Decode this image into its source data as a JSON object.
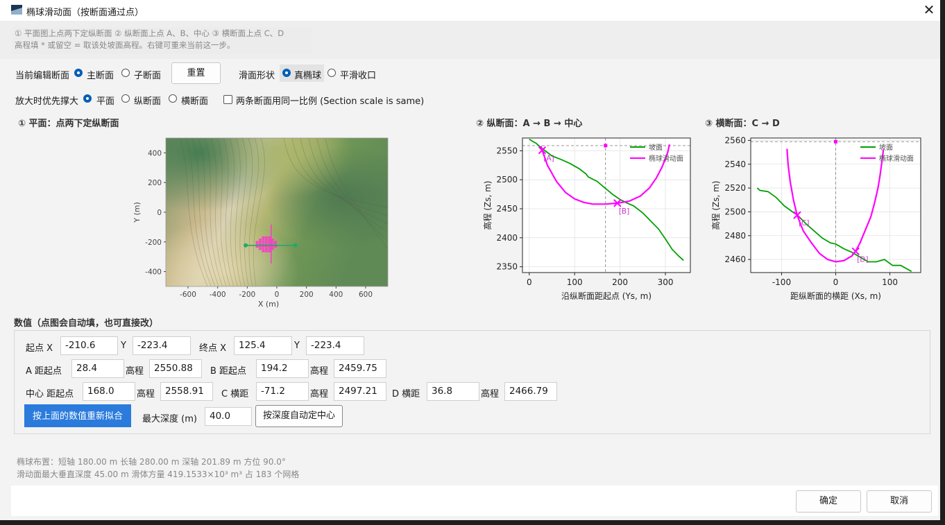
{
  "window": {
    "title": "椭球滑动面（按断面通过点）"
  },
  "hint": {
    "line1": "① 平面图上点两下定纵断面  ② 纵断面上点 A、B、中心  ③ 横断面上点 C、D",
    "line2": "高程填 * 或留空 = 取该处坡面高程。右键可重来当前这一步。"
  },
  "row1": {
    "edit_label": "当前编辑断面",
    "main": "主断面",
    "sub": "子断面",
    "reset": "重置",
    "shape_label": "滑面形状",
    "true_ellipsoid": "真椭球",
    "smooth": "平滑收口"
  },
  "row2": {
    "zoom_label": "放大时优先撑大",
    "plan": "平面",
    "long": "纵断面",
    "cross": "横断面",
    "same_scale": "两条断面用同一比例 (Section scale is same)"
  },
  "plots": {
    "plan_title": "① 平面：点两下定纵断面",
    "long_title": "② 纵断面：A → B → 中心",
    "cross_title": "③ 横断面：C → D"
  },
  "chart_data": [
    {
      "type": "heatmap",
      "title": "① 平面：点两下定纵断面",
      "xlabel": "X (m)",
      "ylabel": "Y (m)",
      "xticks": [
        "-600",
        "-400",
        "-200",
        "0",
        "200",
        "400",
        "600"
      ],
      "yticks": [
        "400",
        "200",
        "0",
        "-200",
        "-400"
      ],
      "xlim": [
        -750,
        750
      ],
      "ylim": [
        -500,
        500
      ],
      "section_line": {
        "x": [
          -210.6,
          125.4
        ],
        "y": [
          -223.4,
          -223.4
        ]
      },
      "slide_center": {
        "x": -15,
        "y": -223.4
      }
    },
    {
      "type": "line",
      "title": "② 纵断面：A → B → 中心",
      "xlabel": "沿纵断面距起点 (Ys, m)",
      "ylabel": "高程 (Zs, m)",
      "xticks": [
        "0",
        "100",
        "200",
        "300"
      ],
      "yticks": [
        "2550",
        "2500",
        "2450",
        "2400",
        "2350"
      ],
      "xlim": [
        -15,
        355
      ],
      "ylim": [
        2340,
        2572
      ],
      "legend": [
        "坡面",
        "椭球滑动面"
      ],
      "legend_colors": [
        "#00a000",
        "#ff00ff"
      ],
      "points": [
        {
          "label": "[A]",
          "x": 28.4,
          "y": 2550.88
        },
        {
          "label": "[B]",
          "x": 194.2,
          "y": 2459.75
        }
      ],
      "center": {
        "x": 168.0,
        "y": 2558.91
      },
      "series": [
        {
          "name": "坡面",
          "x": [
            0,
            8,
            15,
            25,
            35,
            50,
            70,
            90,
            110,
            125,
            130,
            150,
            165,
            185,
            200,
            215,
            230,
            250,
            270,
            285,
            300,
            315,
            330,
            340
          ],
          "y": [
            2570,
            2566,
            2563,
            2556,
            2550,
            2541,
            2535,
            2528,
            2519,
            2510,
            2505,
            2497,
            2487,
            2474,
            2466,
            2460,
            2455,
            2443,
            2427,
            2415,
            2398,
            2380,
            2368,
            2361
          ]
        },
        {
          "name": "椭球滑动面",
          "x": [
            26,
            28.4,
            40,
            60,
            80,
            100,
            120,
            140,
            168,
            194.2,
            220,
            245,
            265,
            280,
            292,
            300,
            305,
            309
          ],
          "y": [
            2558,
            2551,
            2525,
            2497,
            2478,
            2467,
            2461,
            2458,
            2458,
            2459.75,
            2463,
            2472,
            2486,
            2503,
            2521,
            2536,
            2547,
            2561
          ]
        }
      ]
    },
    {
      "type": "line",
      "title": "③ 横断面：C → D",
      "xlabel": "距纵断面的横距 (Xs, m)",
      "ylabel": "高程 (Zs, m)",
      "xticks": [
        "-100",
        "0",
        "100"
      ],
      "yticks": [
        "2560",
        "2540",
        "2520",
        "2500",
        "2480",
        "2460"
      ],
      "xlim": [
        -157,
        157
      ],
      "ylim": [
        2449,
        2562
      ],
      "legend": [
        "坡面",
        "椭球滑动面"
      ],
      "legend_colors": [
        "#00a000",
        "#ff00ff"
      ],
      "points": [
        {
          "label": "[C]",
          "x": -71.2,
          "y": 2497.21
        },
        {
          "label": "[D]",
          "x": 36.8,
          "y": 2466.79
        }
      ],
      "center": {
        "x": 0,
        "y": 2558.91
      },
      "series": [
        {
          "name": "坡面",
          "x": [
            -145,
            -140,
            -125,
            -110,
            -95,
            -80,
            -70,
            -55,
            -40,
            -25,
            -10,
            0,
            15,
            30,
            45,
            60,
            75,
            90,
            105,
            120,
            140
          ],
          "y": [
            2520,
            2518,
            2517,
            2512,
            2505,
            2500,
            2497,
            2490,
            2484,
            2478,
            2474,
            2473,
            2469,
            2466,
            2462,
            2458,
            2458,
            2460,
            2455,
            2455,
            2450
          ]
        },
        {
          "name": "椭球滑动面",
          "x": [
            -90,
            -88,
            -84,
            -78,
            -71.2,
            -60,
            -45,
            -30,
            -15,
            0,
            15,
            30,
            36.8,
            45,
            55,
            65,
            72,
            78,
            82,
            85,
            88
          ],
          "y": [
            2553,
            2540,
            2525,
            2510,
            2497,
            2484,
            2474,
            2465,
            2460,
            2458,
            2459,
            2463,
            2467,
            2474,
            2485,
            2496,
            2508,
            2520,
            2531,
            2541,
            2552
          ]
        }
      ]
    }
  ],
  "values": {
    "section_title": "数值（点图会自动填，也可直接改）",
    "start_x_label": "起点 X",
    "start_x": "-210.6",
    "y_label": "Y",
    "start_y": "-223.4",
    "end_x_label": "终点 X",
    "end_x": "125.4",
    "end_y": "-223.4",
    "a_label": "A 距起点",
    "a_dist": "28.4",
    "elev_label": "高程",
    "a_elev": "2550.88",
    "b_label": "B 距起点",
    "b_dist": "194.2",
    "b_elev": "2459.75",
    "center_label": "中心 距起点",
    "center_dist": "168.0",
    "center_elev": "2558.91",
    "c_label": "C 横距",
    "c_dist": "-71.2",
    "c_elev": "2497.21",
    "d_label": "D 横距",
    "d_dist": "36.8",
    "d_elev": "2466.79",
    "refit": "按上面的数值重新拟合",
    "max_depth_label": "最大深度 (m)",
    "max_depth": "40.0",
    "auto_center": "按深度自动定中心"
  },
  "summary": {
    "line1": "椭球布置：短轴 180.00 m   长轴 280.00 m   深轴 201.89 m   方位 90.0°",
    "line2": "滑动面最大垂直深度 45.00 m   滑体方量 419.1533×10³ m³   占 183 个网格"
  },
  "footer": {
    "ok": "确定",
    "cancel": "取消"
  }
}
